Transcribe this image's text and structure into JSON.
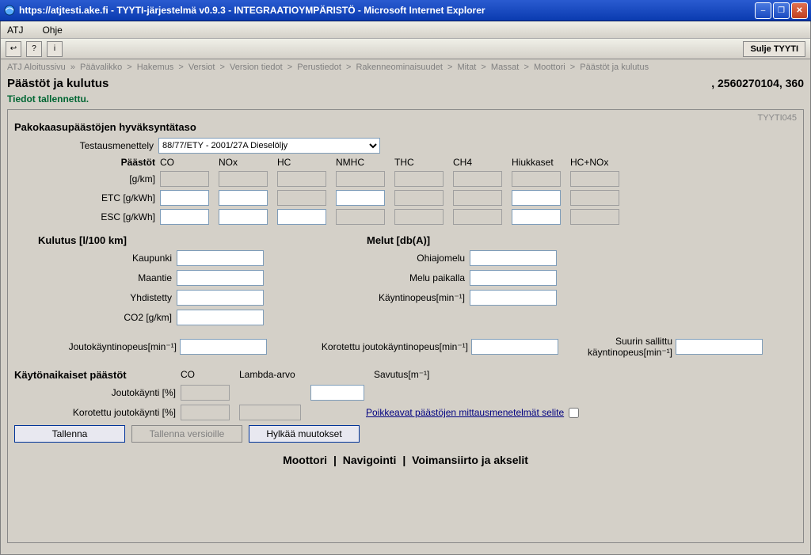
{
  "window": {
    "title": "https://atjtesti.ake.fi - TYYTI-järjestelmä v0.9.3 - INTEGRAATIOYMPÄRISTÖ - Microsoft Internet Explorer"
  },
  "menu": {
    "atj": "ATJ",
    "ohje": "Ohje"
  },
  "toolbar": {
    "back": "↩",
    "help": "?",
    "info": "i",
    "close_tyyti": "Sulje TYYTI"
  },
  "breadcrumb": {
    "items": [
      "ATJ Aloitussivu",
      "Päävalikko",
      "Hakemus",
      "Versiot",
      "Version tiedot",
      "Perustiedot",
      "Rakenneominaisuudet",
      "Mitat",
      "Massat",
      "Moottori",
      "Päästöt ja kulutus"
    ],
    "sep_first": "»",
    "sep": ">"
  },
  "page": {
    "title": "Päästöt ja kulutus",
    "id": ", 2560270104, 360",
    "status": "Tiedot tallennettu.",
    "code": "TYYTI045"
  },
  "approval": {
    "section_title": "Pakokaasupäästöjen hyväksyntätaso",
    "test_method_label": "Testausmenettely",
    "test_method_value": "88/77/ETY - 2001/27A Dieselöljy"
  },
  "emissions": {
    "head_label": "Päästöt",
    "cols": [
      "CO",
      "NOx",
      "HC",
      "NMHC",
      "THC",
      "CH4",
      "Hiukkaset",
      "HC+NOx"
    ],
    "rows": [
      {
        "label": "[g/km]",
        "enabled": [
          false,
          false,
          false,
          false,
          false,
          false,
          false,
          false
        ]
      },
      {
        "label": "ETC [g/kWh]",
        "enabled": [
          true,
          true,
          false,
          true,
          false,
          false,
          true,
          false
        ]
      },
      {
        "label": "ESC [g/kWh]",
        "enabled": [
          true,
          true,
          true,
          false,
          false,
          false,
          true,
          false
        ]
      }
    ]
  },
  "consumption": {
    "title": "Kulutus [l/100 km]",
    "kaupunki": "Kaupunki",
    "maantie": "Maantie",
    "yhdistetty": "Yhdistetty",
    "co2": "CO2 [g/km]"
  },
  "noise": {
    "title": "Melut [db(A)]",
    "ohiajomelu": "Ohiajomelu",
    "melu_paikalla": "Melu paikalla",
    "kayntinopeus": "Käyntinopeus[min⁻¹]"
  },
  "speeds": {
    "jouto": "Joutokäyntinopeus[min⁻¹]",
    "korotettu": "Korotettu joutokäyntinopeus[min⁻¹]",
    "suurin": "Suurin sallittu käyntinopeus[min⁻¹]"
  },
  "runtime": {
    "title": "Käytönaikaiset päästöt",
    "co": "CO",
    "lambda": "Lambda-arvo",
    "savutus": "Savutus[m⁻¹]",
    "jouto_pct": "Joutokäynti [%]",
    "korotettu_pct": "Korotettu joutokäynti [%]",
    "poikkeavat": "Poikkeavat päästöjen mittausmenetelmät selite"
  },
  "buttons": {
    "save": "Tallenna",
    "save_versions": "Tallenna versioille",
    "reject": "Hylkää muutokset"
  },
  "bottom_nav": {
    "moottori": "Moottori",
    "navigointi": "Navigointi",
    "voimansiirto": "Voimansiirto ja akselit"
  }
}
